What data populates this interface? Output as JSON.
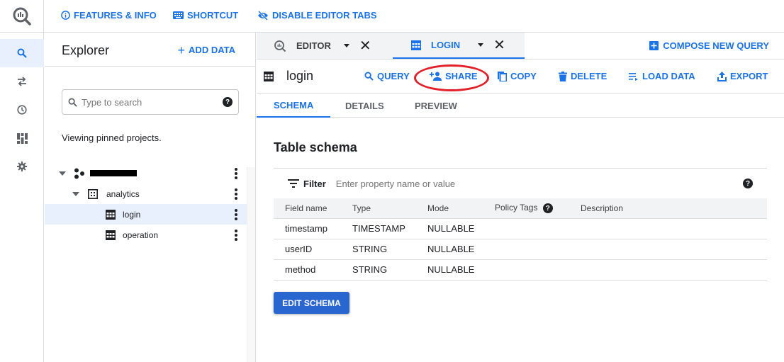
{
  "topbar": {
    "links": [
      {
        "label": "FEATURES & INFO",
        "icon": "info-icon"
      },
      {
        "label": "SHORTCUT",
        "icon": "keyboard-icon"
      },
      {
        "label": "DISABLE EDITOR TABS",
        "icon": "eye-off-icon"
      }
    ]
  },
  "leftnav": {
    "items": [
      {
        "icon": "search-icon",
        "active": true
      },
      {
        "icon": "transfer-icon"
      },
      {
        "icon": "history-icon"
      },
      {
        "icon": "dashboard-icon"
      },
      {
        "icon": "gear-icon"
      }
    ]
  },
  "explorer": {
    "title": "Explorer",
    "add_data_label": "ADD DATA",
    "search_placeholder": "Type to search",
    "viewing_text": "Viewing pinned projects.",
    "tree": [
      {
        "label": "",
        "redacted": true,
        "type": "project",
        "level": 0
      },
      {
        "label": "analytics",
        "type": "dataset",
        "level": 1
      },
      {
        "label": "login",
        "type": "table",
        "level": 2,
        "selected": true
      },
      {
        "label": "operation",
        "type": "table",
        "level": 2
      }
    ]
  },
  "editor_tabs": [
    {
      "label": "EDITOR",
      "icon": "query-icon"
    },
    {
      "label": "LOGIN",
      "icon": "table-icon",
      "active": true
    }
  ],
  "compose_label": "COMPOSE NEW QUERY",
  "toolbar": {
    "title": "login",
    "buttons": [
      {
        "label": "QUERY",
        "icon": "search-icon"
      },
      {
        "label": "SHARE",
        "icon": "person-add-icon",
        "highlighted": true
      },
      {
        "label": "COPY",
        "icon": "copy-icon"
      },
      {
        "label": "DELETE",
        "icon": "trash-icon"
      },
      {
        "label": "LOAD DATA",
        "icon": "load-data-icon"
      },
      {
        "label": "EXPORT",
        "icon": "export-icon"
      }
    ]
  },
  "subtabs": [
    {
      "label": "SCHEMA",
      "active": true
    },
    {
      "label": "DETAILS"
    },
    {
      "label": "PREVIEW"
    }
  ],
  "schema": {
    "title": "Table schema",
    "filter_label": "Filter",
    "filter_placeholder": "Enter property name or value",
    "columns": [
      "Field name",
      "Type",
      "Mode",
      "Policy Tags",
      "Description"
    ],
    "rows": [
      {
        "field": "timestamp",
        "type": "TIMESTAMP",
        "mode": "NULLABLE",
        "policy": "",
        "description": ""
      },
      {
        "field": "userID",
        "type": "STRING",
        "mode": "NULLABLE",
        "policy": "",
        "description": ""
      },
      {
        "field": "method",
        "type": "STRING",
        "mode": "NULLABLE",
        "policy": "",
        "description": ""
      }
    ],
    "edit_label": "EDIT SCHEMA"
  },
  "colors": {
    "accent": "#1a73e8",
    "selected_bg": "#e8f0fe",
    "highlight_ring": "#e3202a",
    "button_bg": "#2966d0"
  }
}
